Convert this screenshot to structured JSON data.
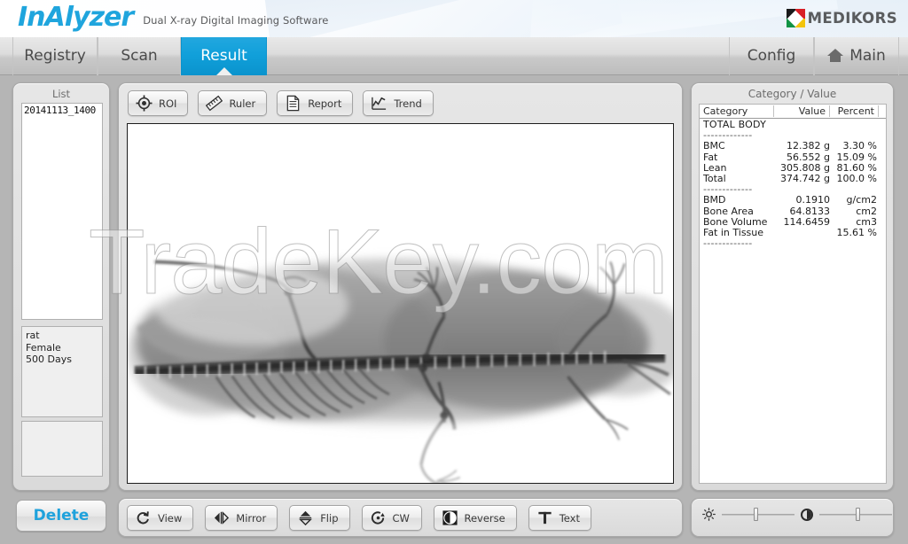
{
  "header": {
    "product_name": "InAlyzer",
    "tagline": "Dual X-ray Digital Imaging Software",
    "brand": "MEDIKORS",
    "brand_icon": "medikors-diamond-icon"
  },
  "tabs": [
    {
      "id": "registry",
      "label": "Registry",
      "active": false
    },
    {
      "id": "scan",
      "label": "Scan",
      "active": false
    },
    {
      "id": "result",
      "label": "Result",
      "active": true
    },
    {
      "id": "config",
      "label": "Config",
      "active": false
    },
    {
      "id": "main",
      "label": "Main",
      "active": false,
      "icon": "home-icon"
    }
  ],
  "list_panel": {
    "title": "List",
    "items": [
      "20141113_1400"
    ],
    "selected": "20141113_1400",
    "subject_info": [
      "rat",
      "Female",
      "500 Days"
    ],
    "delete_label": "Delete"
  },
  "image_toolbar": [
    {
      "id": "roi",
      "label": "ROI",
      "icon": "crosshair-target-icon"
    },
    {
      "id": "ruler",
      "label": "Ruler",
      "icon": "ruler-icon"
    },
    {
      "id": "report",
      "label": "Report",
      "icon": "document-icon"
    },
    {
      "id": "trend",
      "label": "Trend",
      "icon": "line-chart-icon"
    }
  ],
  "bottom_toolbar": [
    {
      "id": "view",
      "label": "View",
      "icon": "refresh-rotate-icon"
    },
    {
      "id": "mirror",
      "label": "Mirror",
      "icon": "mirror-arrows-icon"
    },
    {
      "id": "flip",
      "label": "Flip",
      "icon": "flip-arrows-icon"
    },
    {
      "id": "cw",
      "label": "CW",
      "icon": "rotate-clockwise-icon"
    },
    {
      "id": "reverse",
      "label": "Reverse",
      "icon": "invert-contrast-icon"
    },
    {
      "id": "text",
      "label": "Text",
      "icon": "text-t-icon"
    }
  ],
  "adjust": {
    "brightness": {
      "icon": "brightness-sun-icon",
      "value_pct": 46
    },
    "contrast": {
      "icon": "contrast-half-circle-icon",
      "value_pct": 52
    }
  },
  "results": {
    "title": "Category / Value",
    "columns": [
      "Category",
      "Value",
      "Percent"
    ],
    "rows": [
      {
        "category": "TOTAL BODY",
        "value": "",
        "percent": ""
      },
      {
        "category": "-------------",
        "value": "",
        "percent": ""
      },
      {
        "category": "BMC",
        "value": "12.382 g",
        "percent": "3.30 %"
      },
      {
        "category": "Fat",
        "value": "56.552 g",
        "percent": "15.09 %"
      },
      {
        "category": "Lean",
        "value": "305.808 g",
        "percent": "81.60 %"
      },
      {
        "category": "Total",
        "value": "374.742 g",
        "percent": "100.0 %"
      },
      {
        "category": "-------------",
        "value": "",
        "percent": ""
      },
      {
        "category": "BMD",
        "value": "0.1910",
        "percent": "g/cm2"
      },
      {
        "category": "Bone Area",
        "value": "64.8133",
        "percent": "cm2"
      },
      {
        "category": "Bone Volume",
        "value": "114.6459",
        "percent": "cm3"
      },
      {
        "category": "Fat in Tissue",
        "value": "",
        "percent": "15.61 %"
      },
      {
        "category": "-------------",
        "value": "",
        "percent": ""
      }
    ]
  },
  "watermark": {
    "text": "TradeKey.com"
  },
  "xray": {
    "subject": "rat",
    "view": "whole-body lateral radiograph"
  },
  "colors": {
    "accent": "#11a0da",
    "panel": "#e0e0e0",
    "app_bg": "#b5b5b5",
    "text": "#3a3a3a"
  }
}
